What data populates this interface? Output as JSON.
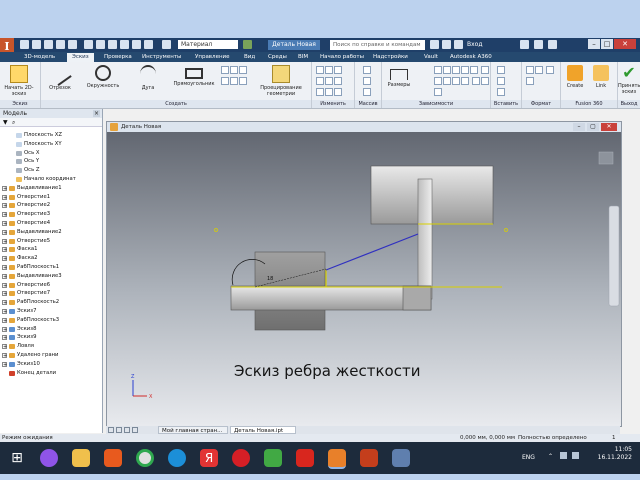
{
  "app": {
    "logo": "I",
    "material": "Материал",
    "doc_title": "Деталь Новая",
    "search_placeholder": "Поиск по справке и командам",
    "user": "Вход"
  },
  "tabs": [
    "3D-модель",
    "Эскиз",
    "Проверка",
    "Инструменты",
    "Управление",
    "Вид",
    "Среды",
    "BIM",
    "Начало работы",
    "Надстройки",
    "Vault",
    "Autodesk A360"
  ],
  "ribbon": {
    "panels": [
      {
        "label": "Эскиз",
        "buttons": [
          "Начать 2D-эскиз"
        ]
      },
      {
        "label": "Создать",
        "buttons": [
          "Отрезок",
          "Окружность",
          "Дуга",
          "Прямоугольник",
          "Проецирование геометрии"
        ]
      },
      {
        "label": "Изменить",
        "buttons": []
      },
      {
        "label": "Массив",
        "buttons": []
      },
      {
        "label": "Зависимости",
        "buttons": [
          "Размеры"
        ]
      },
      {
        "label": "Вставить",
        "buttons": []
      },
      {
        "label": "Формат",
        "buttons": []
      },
      {
        "label": "Fusion 360",
        "buttons": [
          "Create",
          "Link"
        ]
      },
      {
        "label": "Выход",
        "buttons": [
          "Принять эскиз"
        ]
      }
    ]
  },
  "browser": {
    "title": "Модель",
    "items": [
      "Плоскость XZ",
      "Плоскость XY",
      "Ось X",
      "Ось Y",
      "Ось Z",
      "Начало координат",
      "Выдавливание1",
      "Отверстие1",
      "Отверстие2",
      "Отверстие3",
      "Отверстие4",
      "Выдавливание2",
      "Отверстие5",
      "Фаска1",
      "Фаска2",
      "РабПлоскость1",
      "Выдавливание3",
      "Отверстие6",
      "Отверстие7",
      "РабПлоскость2",
      "Эскиз7",
      "РабПлоскость3",
      "Эскиз8",
      "Эскиз9",
      "Ловля",
      "Удалено грани",
      "Эскиз10",
      "Конец детали"
    ]
  },
  "graphics": {
    "window_title": "Деталь Новая",
    "label": "Эскиз ребра жесткости",
    "axis_x": "X",
    "axis_z": "Z",
    "dimension": "18"
  },
  "doc_tabs": [
    "Мой главная стран...",
    "Деталь Новая.ipt"
  ],
  "status": {
    "left": "Режим ожидания",
    "coords": "0,000 мм, 0,000 мм",
    "constraint": "Полностью определено",
    "counts": "1"
  },
  "taskbar": {
    "lang": "ENG",
    "time": "11:05",
    "date": "16.11.2022"
  },
  "colors": {
    "titlebar": "#1f3f68",
    "tabbar": "#25496f",
    "sketch_line": "#3030c0",
    "yellow_edge": "#d8d000"
  }
}
